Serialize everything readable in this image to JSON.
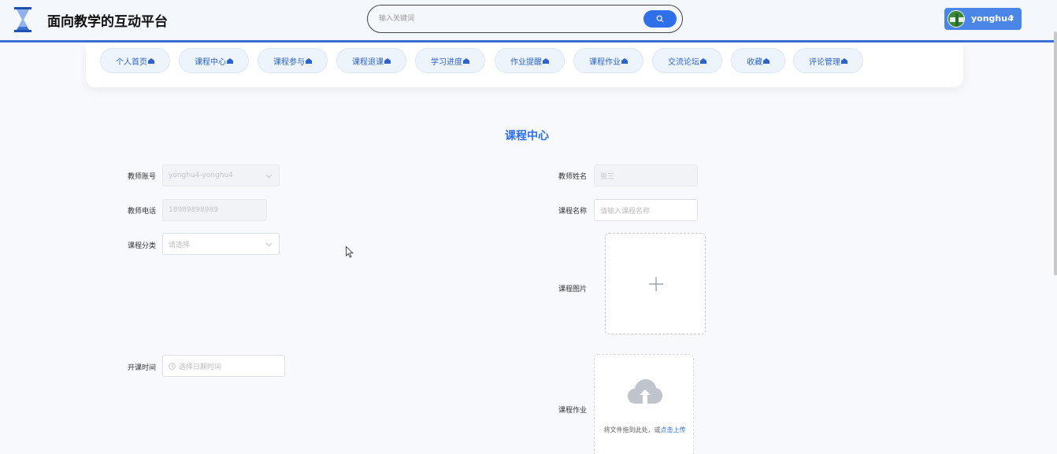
{
  "header": {
    "site_title": "面向教学的互动平台",
    "search_placeholder": "输入关键词",
    "user_name": "yonghu4",
    "accent_color": "#2f6fe8"
  },
  "nav": {
    "items": [
      {
        "label": "个人首页"
      },
      {
        "label": "课程中心"
      },
      {
        "label": "课程参与"
      },
      {
        "label": "课程退课"
      },
      {
        "label": "学习进度"
      },
      {
        "label": "作业提醒"
      },
      {
        "label": "课程作业"
      },
      {
        "label": "交流论坛"
      },
      {
        "label": "收藏"
      },
      {
        "label": "评论管理"
      }
    ],
    "item_icon": "home-icon"
  },
  "page": {
    "title": "课程中心"
  },
  "form": {
    "teacher_account": {
      "label": "教师账号",
      "value": "yonghu4-yonghu4"
    },
    "teacher_name": {
      "label": "教师姓名",
      "value": "张三"
    },
    "teacher_phone": {
      "label": "教师电话",
      "value": "18989898989"
    },
    "course_name": {
      "label": "课程名称",
      "placeholder": "请输入课程名称"
    },
    "course_category": {
      "label": "课程分类",
      "placeholder": "请选择"
    },
    "course_image": {
      "label": "课程图片"
    },
    "start_time": {
      "label": "开课时间",
      "placeholder": "选择日期时间"
    },
    "course_homework": {
      "label": "课程作业",
      "drop_text": "将文件拖到此处，或",
      "click_text": "点击上传"
    }
  }
}
